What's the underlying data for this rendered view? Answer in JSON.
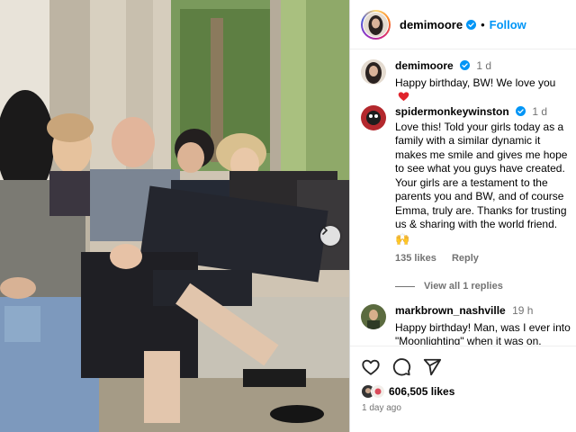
{
  "header": {
    "username": "demimoore",
    "separator": "•",
    "follow_label": "Follow"
  },
  "comments": [
    {
      "username": "demimoore",
      "time": "1 d",
      "text": "Happy birthday, BW! We love you",
      "emoji": "red-heart"
    },
    {
      "username": "spidermonkeywinston",
      "time": "1 d",
      "text": "Love this! Told your girls today as a family with a similar dynamic it makes me smile and gives me hope to see what you guys have created. Your girls are a testament to the parents you and BW, and of course Emma, truly are. Thanks for trusting us & sharing with the world friend.",
      "emoji_line": "🙌",
      "likes": "135 likes",
      "reply_label": "Reply",
      "view_replies": "View all 1 replies"
    },
    {
      "username": "markbrown_nashville",
      "time": "19 h",
      "text": "Happy birthday! Man, was I ever into \"Moonlighting\" when it was on."
    }
  ],
  "actions": {
    "likes_count": "606,505 likes",
    "posted": "1 day ago"
  },
  "icons": [
    "verified-badge",
    "heart-icon",
    "comment-icon",
    "share-icon",
    "next-arrow-icon"
  ],
  "colors": {
    "follow_blue": "#0095f6",
    "verified_blue": "#0095f6",
    "muted": "#737373",
    "heart_red": "#ed4956"
  }
}
